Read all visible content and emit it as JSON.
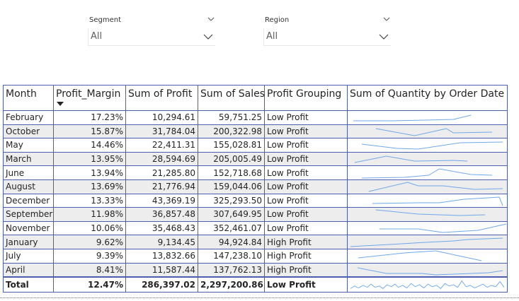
{
  "slicers": {
    "segment": {
      "title": "Segment",
      "value": "All"
    },
    "region": {
      "title": "Region",
      "value": "All"
    }
  },
  "table": {
    "headers": {
      "month": "Month",
      "margin": "Profit_Margin",
      "profit": "Sum of Profit",
      "sales": "Sum of Sales",
      "grouping": "Profit Grouping",
      "quantity": "Sum of Quantity by Order Date"
    },
    "rows": [
      {
        "month": "February",
        "margin": "17.23%",
        "profit": "10,294.61",
        "sales": "59,751.25",
        "grouping": "Low Profit"
      },
      {
        "month": "October",
        "margin": "15.87%",
        "profit": "31,784.04",
        "sales": "200,322.98",
        "grouping": "Low Profit"
      },
      {
        "month": "May",
        "margin": "14.46%",
        "profit": "22,411.31",
        "sales": "155,028.81",
        "grouping": "Low Profit"
      },
      {
        "month": "March",
        "margin": "13.95%",
        "profit": "28,594.69",
        "sales": "205,005.49",
        "grouping": "Low Profit"
      },
      {
        "month": "June",
        "margin": "13.94%",
        "profit": "21,285.80",
        "sales": "152,718.68",
        "grouping": "Low Profit"
      },
      {
        "month": "August",
        "margin": "13.69%",
        "profit": "21,776.94",
        "sales": "159,044.06",
        "grouping": "Low Profit"
      },
      {
        "month": "December",
        "margin": "13.33%",
        "profit": "43,369.19",
        "sales": "325,293.50",
        "grouping": "Low Profit"
      },
      {
        "month": "September",
        "margin": "11.98%",
        "profit": "36,857.48",
        "sales": "307,649.95",
        "grouping": "Low Profit"
      },
      {
        "month": "November",
        "margin": "10.06%",
        "profit": "35,468.43",
        "sales": "352,461.07",
        "grouping": "Low Profit"
      },
      {
        "month": "January",
        "margin": "9.62%",
        "profit": "9,134.45",
        "sales": "94,924.84",
        "grouping": "High Profit"
      },
      {
        "month": "July",
        "margin": "9.39%",
        "profit": "13,832.66",
        "sales": "147,238.10",
        "grouping": "High Profit"
      },
      {
        "month": "April",
        "margin": "8.41%",
        "profit": "11,587.44",
        "sales": "137,762.13",
        "grouping": "High Profit"
      }
    ],
    "total": {
      "month": "Total",
      "margin": "12.47%",
      "profit": "286,397.02",
      "sales": "2,297,200.86",
      "grouping": "Low Profit"
    }
  },
  "sparkline_color": "#6fa8e8",
  "sort": {
    "column": "Profit_Margin",
    "direction": "descending"
  }
}
